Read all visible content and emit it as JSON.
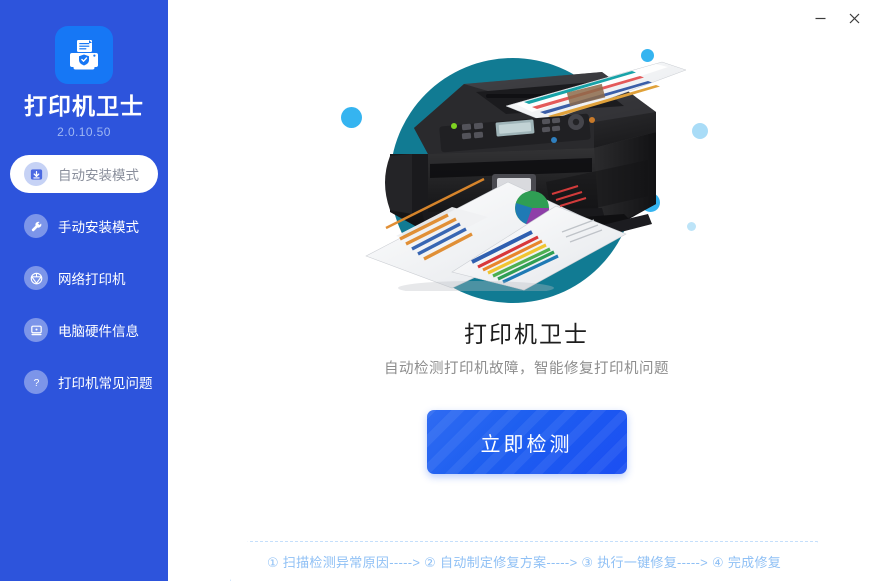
{
  "window": {
    "minimize_label": "—",
    "close_label": "✕"
  },
  "sidebar": {
    "brand_name": "打印机卫士",
    "version": "2.0.10.50",
    "logo_icon": "printer-shield-icon",
    "accent_color": "#2d54dc",
    "items": [
      {
        "label": "自动安装模式",
        "icon": "download-box-icon",
        "active": true
      },
      {
        "label": "手动安装模式",
        "icon": "wrench-icon",
        "active": false
      },
      {
        "label": "网络打印机",
        "icon": "network-globe-icon",
        "active": false
      },
      {
        "label": "电脑硬件信息",
        "icon": "monitor-icon",
        "active": false
      },
      {
        "label": "打印机常见问题",
        "icon": "question-mark-icon",
        "active": false
      }
    ]
  },
  "main": {
    "illustration": "printer-photo",
    "title": "打印机卫士",
    "subtitle": "自动检测打印机故障，智能修复打印机问题",
    "cta_label": "立即检测",
    "cta_color": "#1e5ff0",
    "steps": [
      "① 扫描检测异常原因",
      "② 自动制定修复方案",
      "③ 执行一键修复",
      "④ 完成修复"
    ],
    "step_separator": "----->",
    "steps_text": "① 扫描检测异常原因-----> ② 自动制定修复方案-----> ③ 执行一键修复-----> ④ 完成修复"
  }
}
